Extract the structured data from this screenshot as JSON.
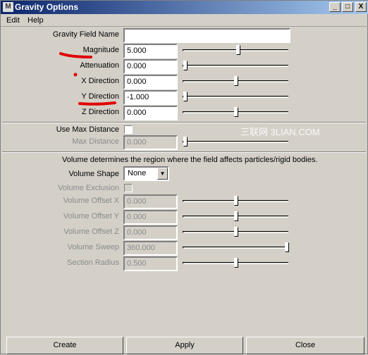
{
  "window": {
    "title": "Gravity Options",
    "icon": "maya-icon",
    "controls": [
      "_",
      "□",
      "X"
    ]
  },
  "menu": [
    "Edit",
    "Help"
  ],
  "field_name": {
    "label": "Gravity Field Name",
    "value": ""
  },
  "rows": [
    {
      "label": "Magnitude",
      "value": "5.000",
      "slider_level": 0.52,
      "enabled": true
    },
    {
      "label": "Attenuation",
      "value": "0.000",
      "slider_level": 0.0,
      "enabled": true
    },
    {
      "label": "X Direction",
      "value": "0.000",
      "slider_level": 0.5,
      "enabled": true
    },
    {
      "label": "Y Direction",
      "value": "-1.000",
      "slider_level": 0.0,
      "enabled": true
    },
    {
      "label": "Z Direction",
      "value": "0.000",
      "slider_level": 0.5,
      "enabled": true
    }
  ],
  "use_max_distance": {
    "label": "Use Max Distance",
    "checked": false
  },
  "max_distance": {
    "label": "Max Distance",
    "value": "0.000",
    "slider_level": 0.0,
    "enabled": false
  },
  "volume_note": "Volume determines the region where the field affects particles/rigid bodies.",
  "volume_shape": {
    "label": "Volume Shape",
    "value": "None"
  },
  "volume_exclusion": {
    "label": "Volume Exclusion",
    "checked": false,
    "enabled": false
  },
  "volume_rows": [
    {
      "label": "Volume Offset X",
      "value": "0.000",
      "slider_level": 0.5,
      "enabled": false
    },
    {
      "label": "Volume Offset Y",
      "value": "0.000",
      "slider_level": 0.5,
      "enabled": false
    },
    {
      "label": "Volume Offset Z",
      "value": "0.000",
      "slider_level": 0.5,
      "enabled": false
    },
    {
      "label": "Volume Sweep",
      "value": "360.000",
      "slider_level": 1.0,
      "enabled": false
    },
    {
      "label": "Section Radius",
      "value": "0.500",
      "slider_level": 0.5,
      "enabled": false
    }
  ],
  "watermark": "三联网 3LIAN.COM",
  "buttons": {
    "create": "Create",
    "apply": "Apply",
    "close": "Close"
  },
  "colors": {
    "annotation": "#e00000",
    "titlebar_start": "#0a246a",
    "titlebar_end": "#a6caf0"
  }
}
